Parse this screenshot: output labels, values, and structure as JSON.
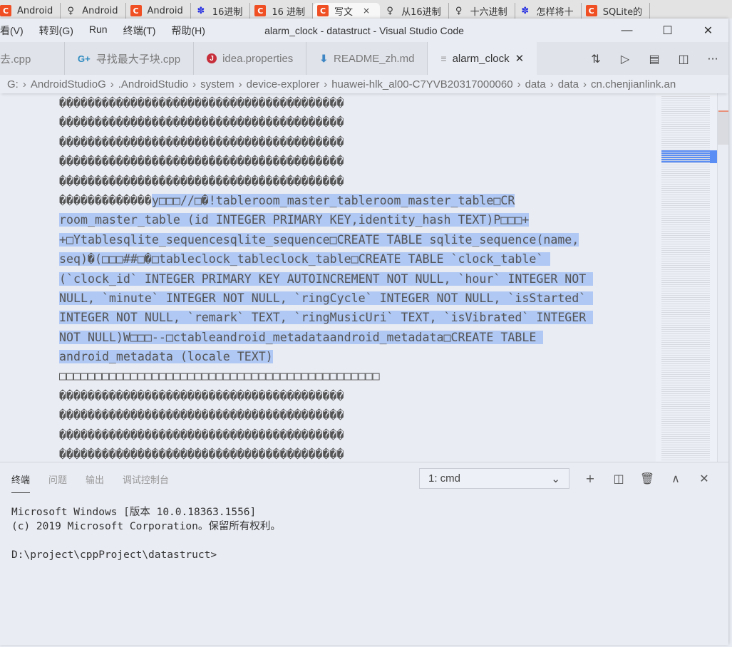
{
  "browser": {
    "tabs": [
      {
        "icon": "csdn-icon",
        "label": "Android"
      },
      {
        "icon": "jianshu-icon",
        "label": "Android"
      },
      {
        "icon": "csdn-icon",
        "label": "Android"
      },
      {
        "icon": "baidu-icon",
        "label": "16进制"
      },
      {
        "icon": "csdn-icon",
        "label": "16 进制"
      },
      {
        "icon": "csdn-icon",
        "label": "写文",
        "active": true,
        "close": "×"
      },
      {
        "icon": "jianshu-icon",
        "label": "从16进制"
      },
      {
        "icon": "jianshu-icon",
        "label": "十六进制"
      },
      {
        "icon": "baidu-icon",
        "label": "怎样将十"
      },
      {
        "icon": "csdn-icon",
        "label": "SQLite的"
      }
    ]
  },
  "titlebar": {
    "menu": [
      "看(V)",
      "转到(G)",
      "Run",
      "终端(T)",
      "帮助(H)"
    ],
    "title": "alarm_clock - datastruct - Visual Studio Code",
    "controls": {
      "minimize": "—",
      "maximize": "☐",
      "close": "✕"
    }
  },
  "editor_tabs": [
    {
      "icon": "",
      "label": "去.cpp"
    },
    {
      "icon": "G+",
      "label": "寻找最大子块.cpp"
    },
    {
      "icon": "J",
      "label": "idea.properties"
    },
    {
      "icon": "⬇",
      "label": "README_zh.md"
    },
    {
      "icon": "≡",
      "label": "alarm_clock",
      "active": true,
      "close": "✕"
    }
  ],
  "editor_actions": [
    "open-changes",
    "run",
    "hex-editor",
    "split-editor",
    "more"
  ],
  "editor_action_glyphs": {
    "open-changes": "⇅",
    "run": "▷",
    "hex-editor": "▤",
    "split-editor": "◫",
    "more": "···"
  },
  "breadcrumb": [
    "G:",
    "AndroidStudioG",
    ".AndroidStudio",
    "system",
    "device-explorer",
    "huawei-hlk_al00-C7YVB20317000060",
    "data",
    "data",
    "cn.chenjianlink.an"
  ],
  "breadcrumb_sep": "›",
  "code_lines": [
    {
      "text": "����������������������������������������",
      "selected": false
    },
    {
      "text": "����������������������������������������",
      "selected": false
    },
    {
      "text": "����������������������������������������",
      "selected": false
    },
    {
      "text": "����������������������������������������",
      "selected": false
    },
    {
      "text": "����������������������������������������",
      "selected": false
    },
    {
      "pre": "�������������",
      "text": "y□□□//□�!tableroom_master_tableroom_master_table□CR",
      "selected": true
    },
    {
      "text": "room_master_table (id INTEGER PRIMARY KEY,identity_hash TEXT)P□□□+",
      "selected": true
    },
    {
      "text": "+□Ytablesqlite_sequencesqlite_sequence□CREATE TABLE sqlite_sequence(name,",
      "selected": true
    },
    {
      "text": "seq)�(□□□##□�□tableclock_tableclock_table□CREATE TABLE `clock_table` ",
      "selected": true
    },
    {
      "text": "(`clock_id` INTEGER PRIMARY KEY AUTOINCREMENT NOT NULL, `hour` INTEGER NOT ",
      "selected": true
    },
    {
      "text": "NULL, `minute` INTEGER NOT NULL, `ringCycle` INTEGER NOT NULL, `isStarted` ",
      "selected": true
    },
    {
      "text": "INTEGER NOT NULL, `remark` TEXT, `ringMusicUri` TEXT, `isVibrated` INTEGER ",
      "selected": true
    },
    {
      "text": "NOT NULL)W□□□--□ctableandroid_metadataandroid_metadata□CREATE TABLE ",
      "selected": true
    },
    {
      "text": "android_metadata (locale TEXT)",
      "selected": true
    },
    {
      "text": "□□□□□□□□□□□□□□□□□□□□□□□□□□□□□□□□□□□□□□□□□□□□□",
      "selected": false
    },
    {
      "text": "����������������������������������������",
      "selected": false
    },
    {
      "text": "����������������������������������������",
      "selected": false
    },
    {
      "text": "����������������������������������������",
      "selected": false
    },
    {
      "text": "����������������������������������������",
      "selected": false
    }
  ],
  "panel": {
    "tabs": [
      {
        "label": "终端",
        "active": true
      },
      {
        "label": "问题"
      },
      {
        "label": "输出"
      },
      {
        "label": "调试控制台"
      }
    ],
    "terminal_select": "1: cmd",
    "terminal_select_chevron": "⌄",
    "actions": [
      {
        "name": "new-terminal",
        "glyph": "+"
      },
      {
        "name": "split-terminal",
        "glyph": "◫"
      },
      {
        "name": "kill-terminal",
        "glyph": "🗑"
      },
      {
        "name": "maximize-panel",
        "glyph": "∧"
      },
      {
        "name": "close-panel",
        "glyph": "✕"
      }
    ],
    "terminal_lines": [
      "Microsoft Windows [版本 10.0.18363.1556]",
      "(c) 2019 Microsoft Corporation。保留所有权利。",
      "",
      "D:\\project\\cppProject\\datastruct>"
    ]
  },
  "colors": {
    "selection": "#b0c8f4",
    "minimap_selection": "#5b8ef5",
    "background": "#e9ecf3"
  }
}
